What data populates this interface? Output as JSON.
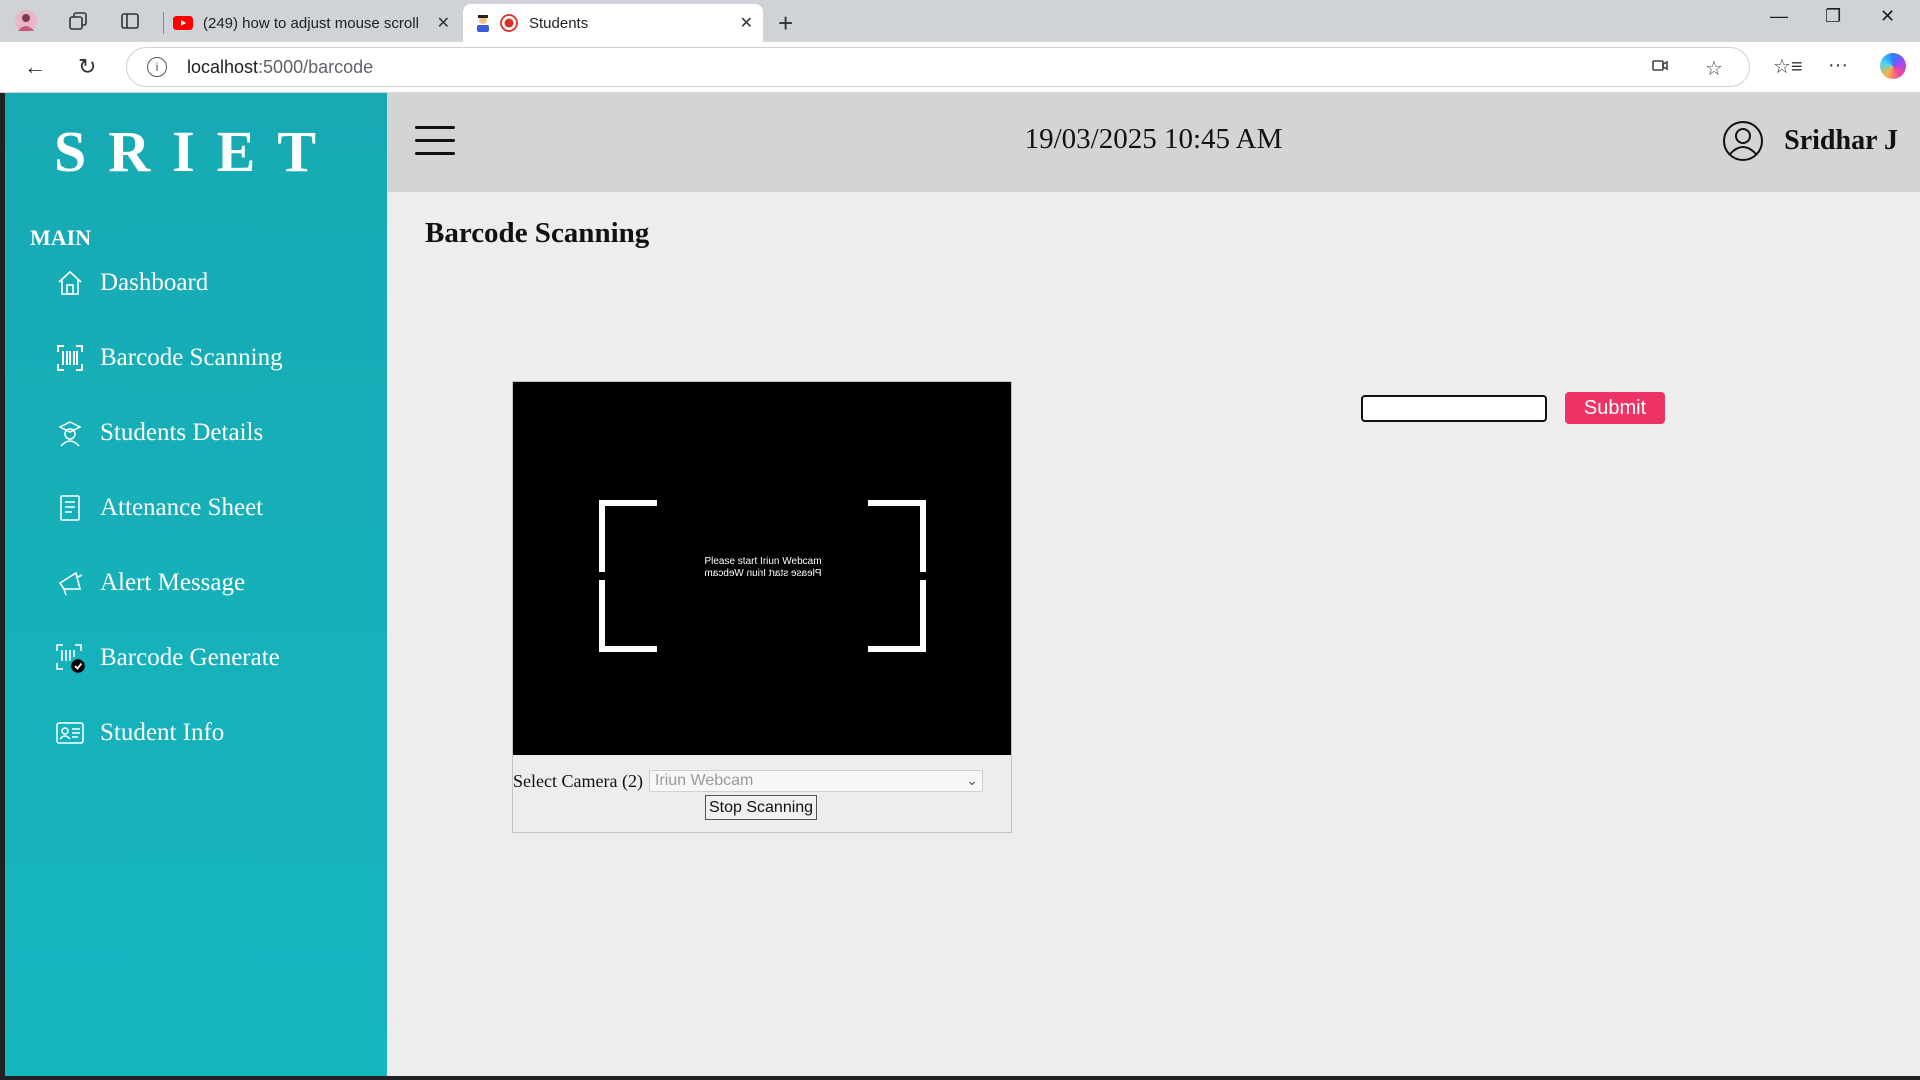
{
  "browser": {
    "tabs": [
      {
        "title": "(249) how to adjust mouse scroll"
      },
      {
        "title": "Students"
      }
    ],
    "url_host": "localhost",
    "url_path": ":5000/barcode"
  },
  "app": {
    "logo": "SRIET",
    "section_label": "MAIN",
    "nav": [
      {
        "label": "Dashboard",
        "icon": "home-icon"
      },
      {
        "label": "Barcode Scanning",
        "icon": "barcode-scan-icon"
      },
      {
        "label": "Students Details",
        "icon": "student-icon"
      },
      {
        "label": "Attenance Sheet",
        "icon": "sheet-icon"
      },
      {
        "label": "Alert Message",
        "icon": "megaphone-icon"
      },
      {
        "label": "Barcode Generate",
        "icon": "barcode-generate-icon"
      },
      {
        "label": "Student Info",
        "icon": "id-card-icon"
      }
    ],
    "header": {
      "datetime": "19/03/2025 10:45 AM",
      "user_name": "Sridhar J"
    },
    "page_title": "Barcode Scanning",
    "scanner": {
      "video_message": "Please start Iriun Webcam",
      "camera_label": "Select Camera (2)",
      "camera_selected": "Iriun Webcam",
      "stop_button": "Stop Scanning"
    },
    "form": {
      "input_value": "",
      "submit_label": "Submit"
    },
    "colors": {
      "sidebar": "#16b0b9",
      "submit": "#ee3366",
      "header": "#d4d4d4"
    }
  }
}
